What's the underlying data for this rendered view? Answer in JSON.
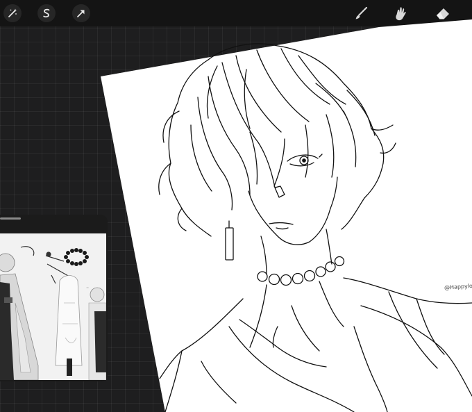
{
  "toolbar": {
    "left_tools": [
      {
        "icon": "magic-wand-icon"
      },
      {
        "icon": "selection-s-icon"
      },
      {
        "icon": "transform-arrow-icon"
      }
    ],
    "right_tools": [
      {
        "icon": "brush-icon"
      },
      {
        "icon": "smudge-icon"
      },
      {
        "icon": "eraser-icon"
      }
    ]
  },
  "canvas": {
    "signature": "@Happylove"
  },
  "colors": {
    "background": "#1e1e1f",
    "toolbar": "#141414",
    "paper": "#ffffff",
    "ink": "#111111"
  }
}
